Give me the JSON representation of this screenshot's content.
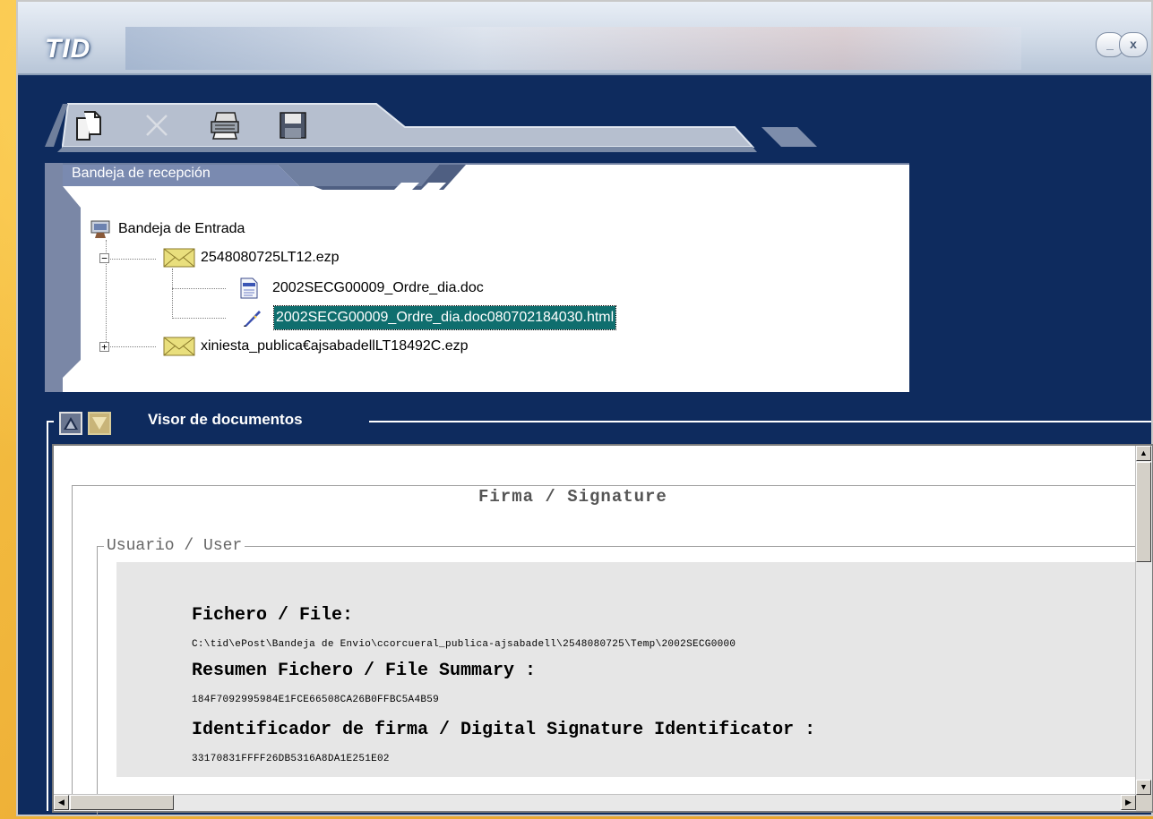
{
  "window": {
    "title": "TID",
    "minimize_label": "_",
    "close_label": "x"
  },
  "toolbar": {
    "icons": [
      "open-document-icon",
      "delete-cross-icon",
      "print-icon",
      "save-disk-icon"
    ]
  },
  "inbox": {
    "tab_label": "Bandeja de recepción",
    "tree": {
      "root": "Bandeja de Entrada",
      "items": [
        {
          "label": "2548080725LT12.ezp",
          "expander": "−"
        },
        {
          "label": "2002SECG00009_Ordre_dia.doc"
        },
        {
          "label": "2002SECG00009_Ordre_dia.doc080702184030.html"
        },
        {
          "label": "xiniesta_publica€ajsabadellLT18492C.ezp",
          "expander": "+"
        }
      ]
    }
  },
  "viewer": {
    "title": "Visor de documentos",
    "section_title": "Firma / Signature",
    "subsection_title": "Usuario / User",
    "fields": [
      {
        "label": "Fichero / File:",
        "value": "C:\\tid\\ePost\\Bandeja de Envio\\ccorcueral_publica-ajsabadell\\2548080725\\Temp\\2002SECG0000"
      },
      {
        "label": "Resumen Fichero / File Summary :",
        "value": "184F7092995984E1FCE66508CA26B0FFBC5A4B59"
      },
      {
        "label": "Identificador de firma / Digital Signature Identificator :",
        "value": "33170831FFFF26DB5316A8DA1E251E02"
      }
    ]
  },
  "colors": {
    "window_bg": "#0e2b5e",
    "selection_bg": "#0f6e6e",
    "desktop_bg": "#f0b93a"
  }
}
